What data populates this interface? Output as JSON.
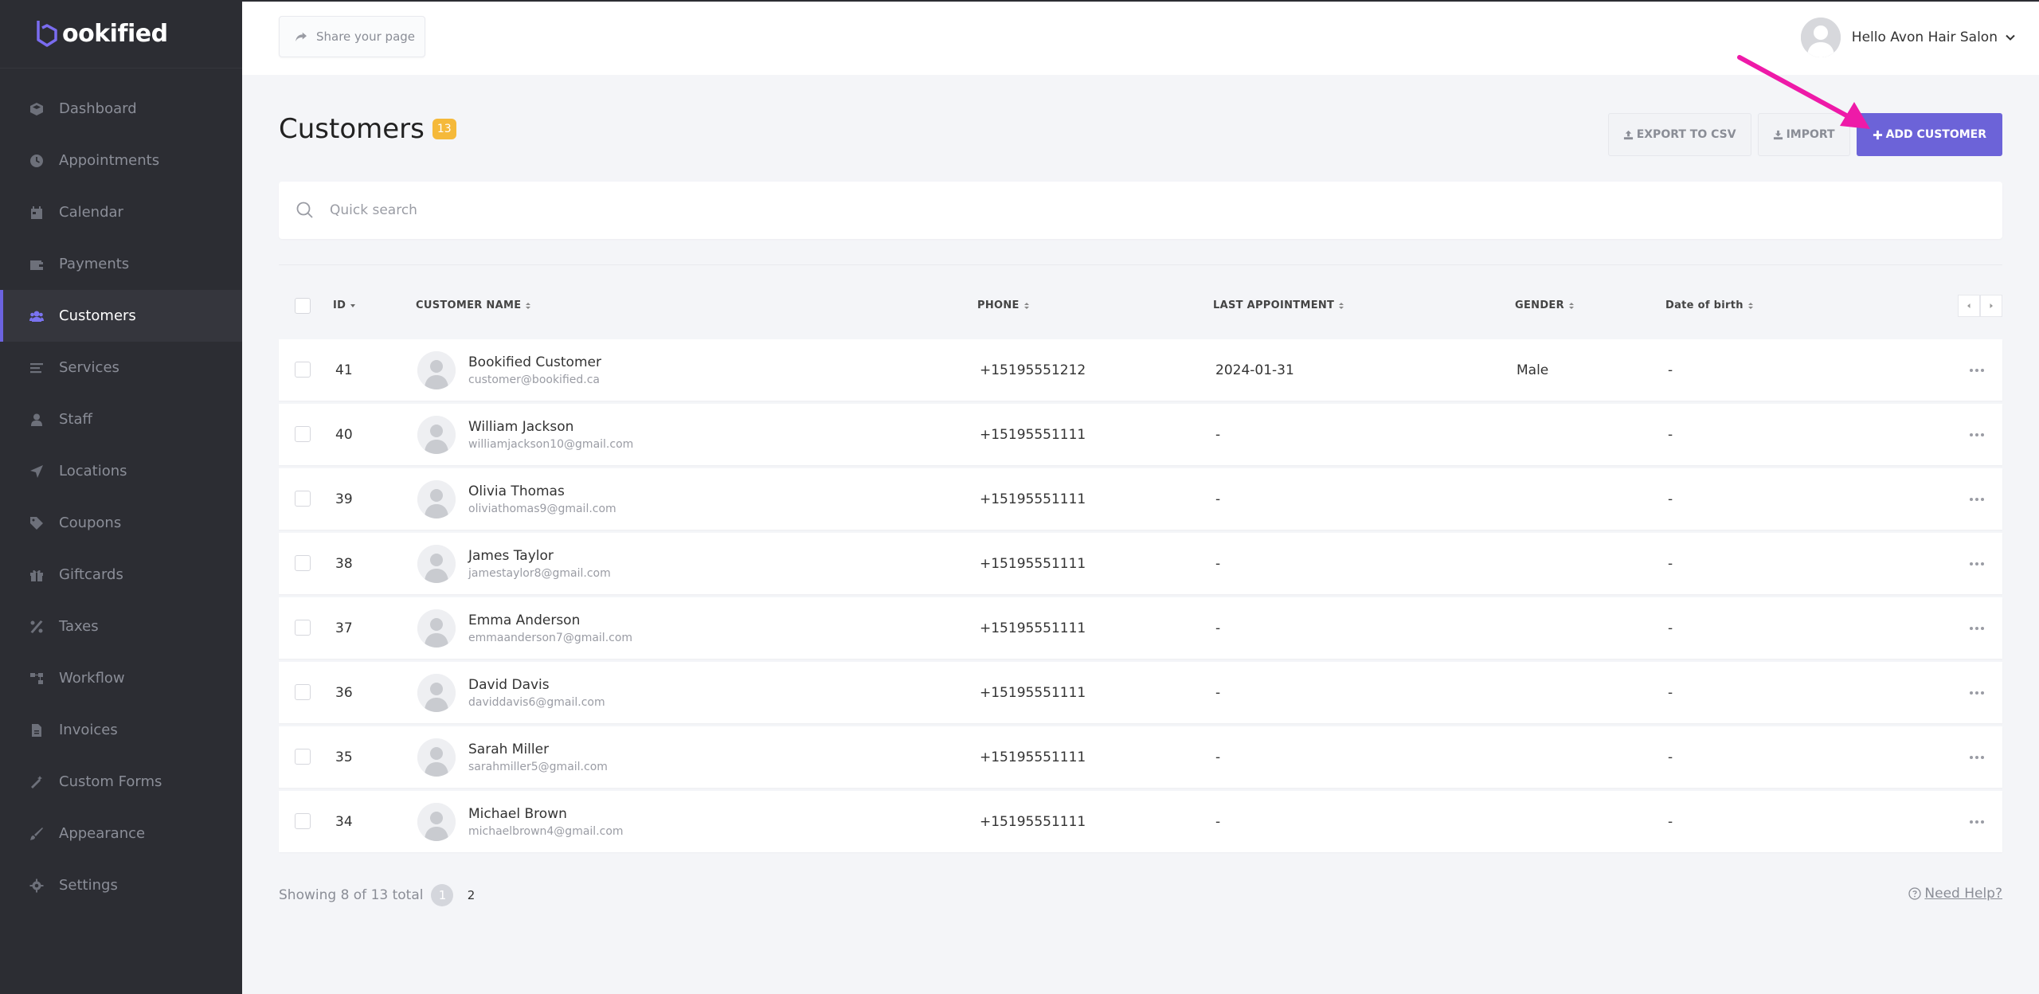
{
  "brand": {
    "name": "ookified"
  },
  "sidebar": {
    "items": [
      {
        "label": "Dashboard",
        "icon": "dashboard-icon"
      },
      {
        "label": "Appointments",
        "icon": "clock-icon"
      },
      {
        "label": "Calendar",
        "icon": "calendar-icon"
      },
      {
        "label": "Payments",
        "icon": "wallet-icon"
      },
      {
        "label": "Customers",
        "icon": "users-icon",
        "active": true
      },
      {
        "label": "Services",
        "icon": "list-icon"
      },
      {
        "label": "Staff",
        "icon": "user-icon"
      },
      {
        "label": "Locations",
        "icon": "location-arrow-icon"
      },
      {
        "label": "Coupons",
        "icon": "tag-icon"
      },
      {
        "label": "Giftcards",
        "icon": "gift-icon"
      },
      {
        "label": "Taxes",
        "icon": "percent-icon"
      },
      {
        "label": "Workflow",
        "icon": "workflow-icon"
      },
      {
        "label": "Invoices",
        "icon": "file-icon"
      },
      {
        "label": "Custom Forms",
        "icon": "magic-icon"
      },
      {
        "label": "Appearance",
        "icon": "brush-icon"
      },
      {
        "label": "Settings",
        "icon": "gear-icon"
      }
    ]
  },
  "topbar": {
    "share_label": "Share your page",
    "user_greeting": "Hello Avon Hair Salon"
  },
  "page": {
    "title": "Customers",
    "count": "13",
    "export_label": "EXPORT TO CSV",
    "import_label": "IMPORT",
    "add_label": "ADD CUSTOMER"
  },
  "search": {
    "placeholder": "Quick search"
  },
  "table": {
    "columns": {
      "id": "ID",
      "name": "CUSTOMER NAME",
      "phone": "PHONE",
      "last_appointment": "LAST APPOINTMENT",
      "gender": "GENDER",
      "dob": "Date of birth"
    },
    "rows": [
      {
        "id": "41",
        "name": "Bookified Customer",
        "email": "customer@bookified.ca",
        "phone": "+15195551212",
        "last_appointment": "2024-01-31",
        "gender": "Male",
        "dob": "-"
      },
      {
        "id": "40",
        "name": "William Jackson",
        "email": "williamjackson10@gmail.com",
        "phone": "+15195551111",
        "last_appointment": "-",
        "gender": "",
        "dob": "-"
      },
      {
        "id": "39",
        "name": "Olivia Thomas",
        "email": "oliviathomas9@gmail.com",
        "phone": "+15195551111",
        "last_appointment": "-",
        "gender": "",
        "dob": "-"
      },
      {
        "id": "38",
        "name": "James Taylor",
        "email": "jamestaylor8@gmail.com",
        "phone": "+15195551111",
        "last_appointment": "-",
        "gender": "",
        "dob": "-"
      },
      {
        "id": "37",
        "name": "Emma Anderson",
        "email": "emmaanderson7@gmail.com",
        "phone": "+15195551111",
        "last_appointment": "-",
        "gender": "",
        "dob": "-"
      },
      {
        "id": "36",
        "name": "David Davis",
        "email": "daviddavis6@gmail.com",
        "phone": "+15195551111",
        "last_appointment": "-",
        "gender": "",
        "dob": "-"
      },
      {
        "id": "35",
        "name": "Sarah Miller",
        "email": "sarahmiller5@gmail.com",
        "phone": "+15195551111",
        "last_appointment": "-",
        "gender": "",
        "dob": "-"
      },
      {
        "id": "34",
        "name": "Michael Brown",
        "email": "michaelbrown4@gmail.com",
        "phone": "+15195551111",
        "last_appointment": "-",
        "gender": "",
        "dob": "-"
      }
    ]
  },
  "footer": {
    "showing": "Showing 8 of 13 total",
    "pages": [
      "1",
      "2"
    ],
    "current_page": "1",
    "help_label": "Need Help?"
  },
  "colors": {
    "accent": "#6c63d8",
    "badge": "#f5b93a",
    "sidebar_bg": "#2c2d33",
    "annotation": "#ee1aa8"
  }
}
